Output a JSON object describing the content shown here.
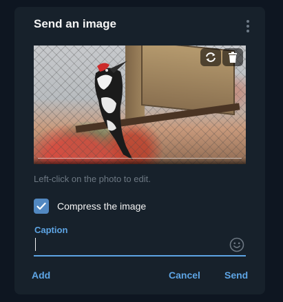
{
  "dialog": {
    "title": "Send an image",
    "hint": "Left-click on the photo to edit.",
    "compress": {
      "label": "Compress the image",
      "checked": true
    },
    "caption": {
      "label": "Caption",
      "value": ""
    },
    "buttons": {
      "add": "Add",
      "cancel": "Cancel",
      "send": "Send"
    }
  },
  "icons": {
    "menu": "more-vertical-icon",
    "replace": "replace-icon",
    "delete": "trash-icon",
    "emoji": "emoji-icon",
    "check": "check-icon"
  },
  "colors": {
    "background": "#0e1621",
    "dialog": "#17212b",
    "accent": "#5ea5e5",
    "checkbox": "#5288c1"
  }
}
